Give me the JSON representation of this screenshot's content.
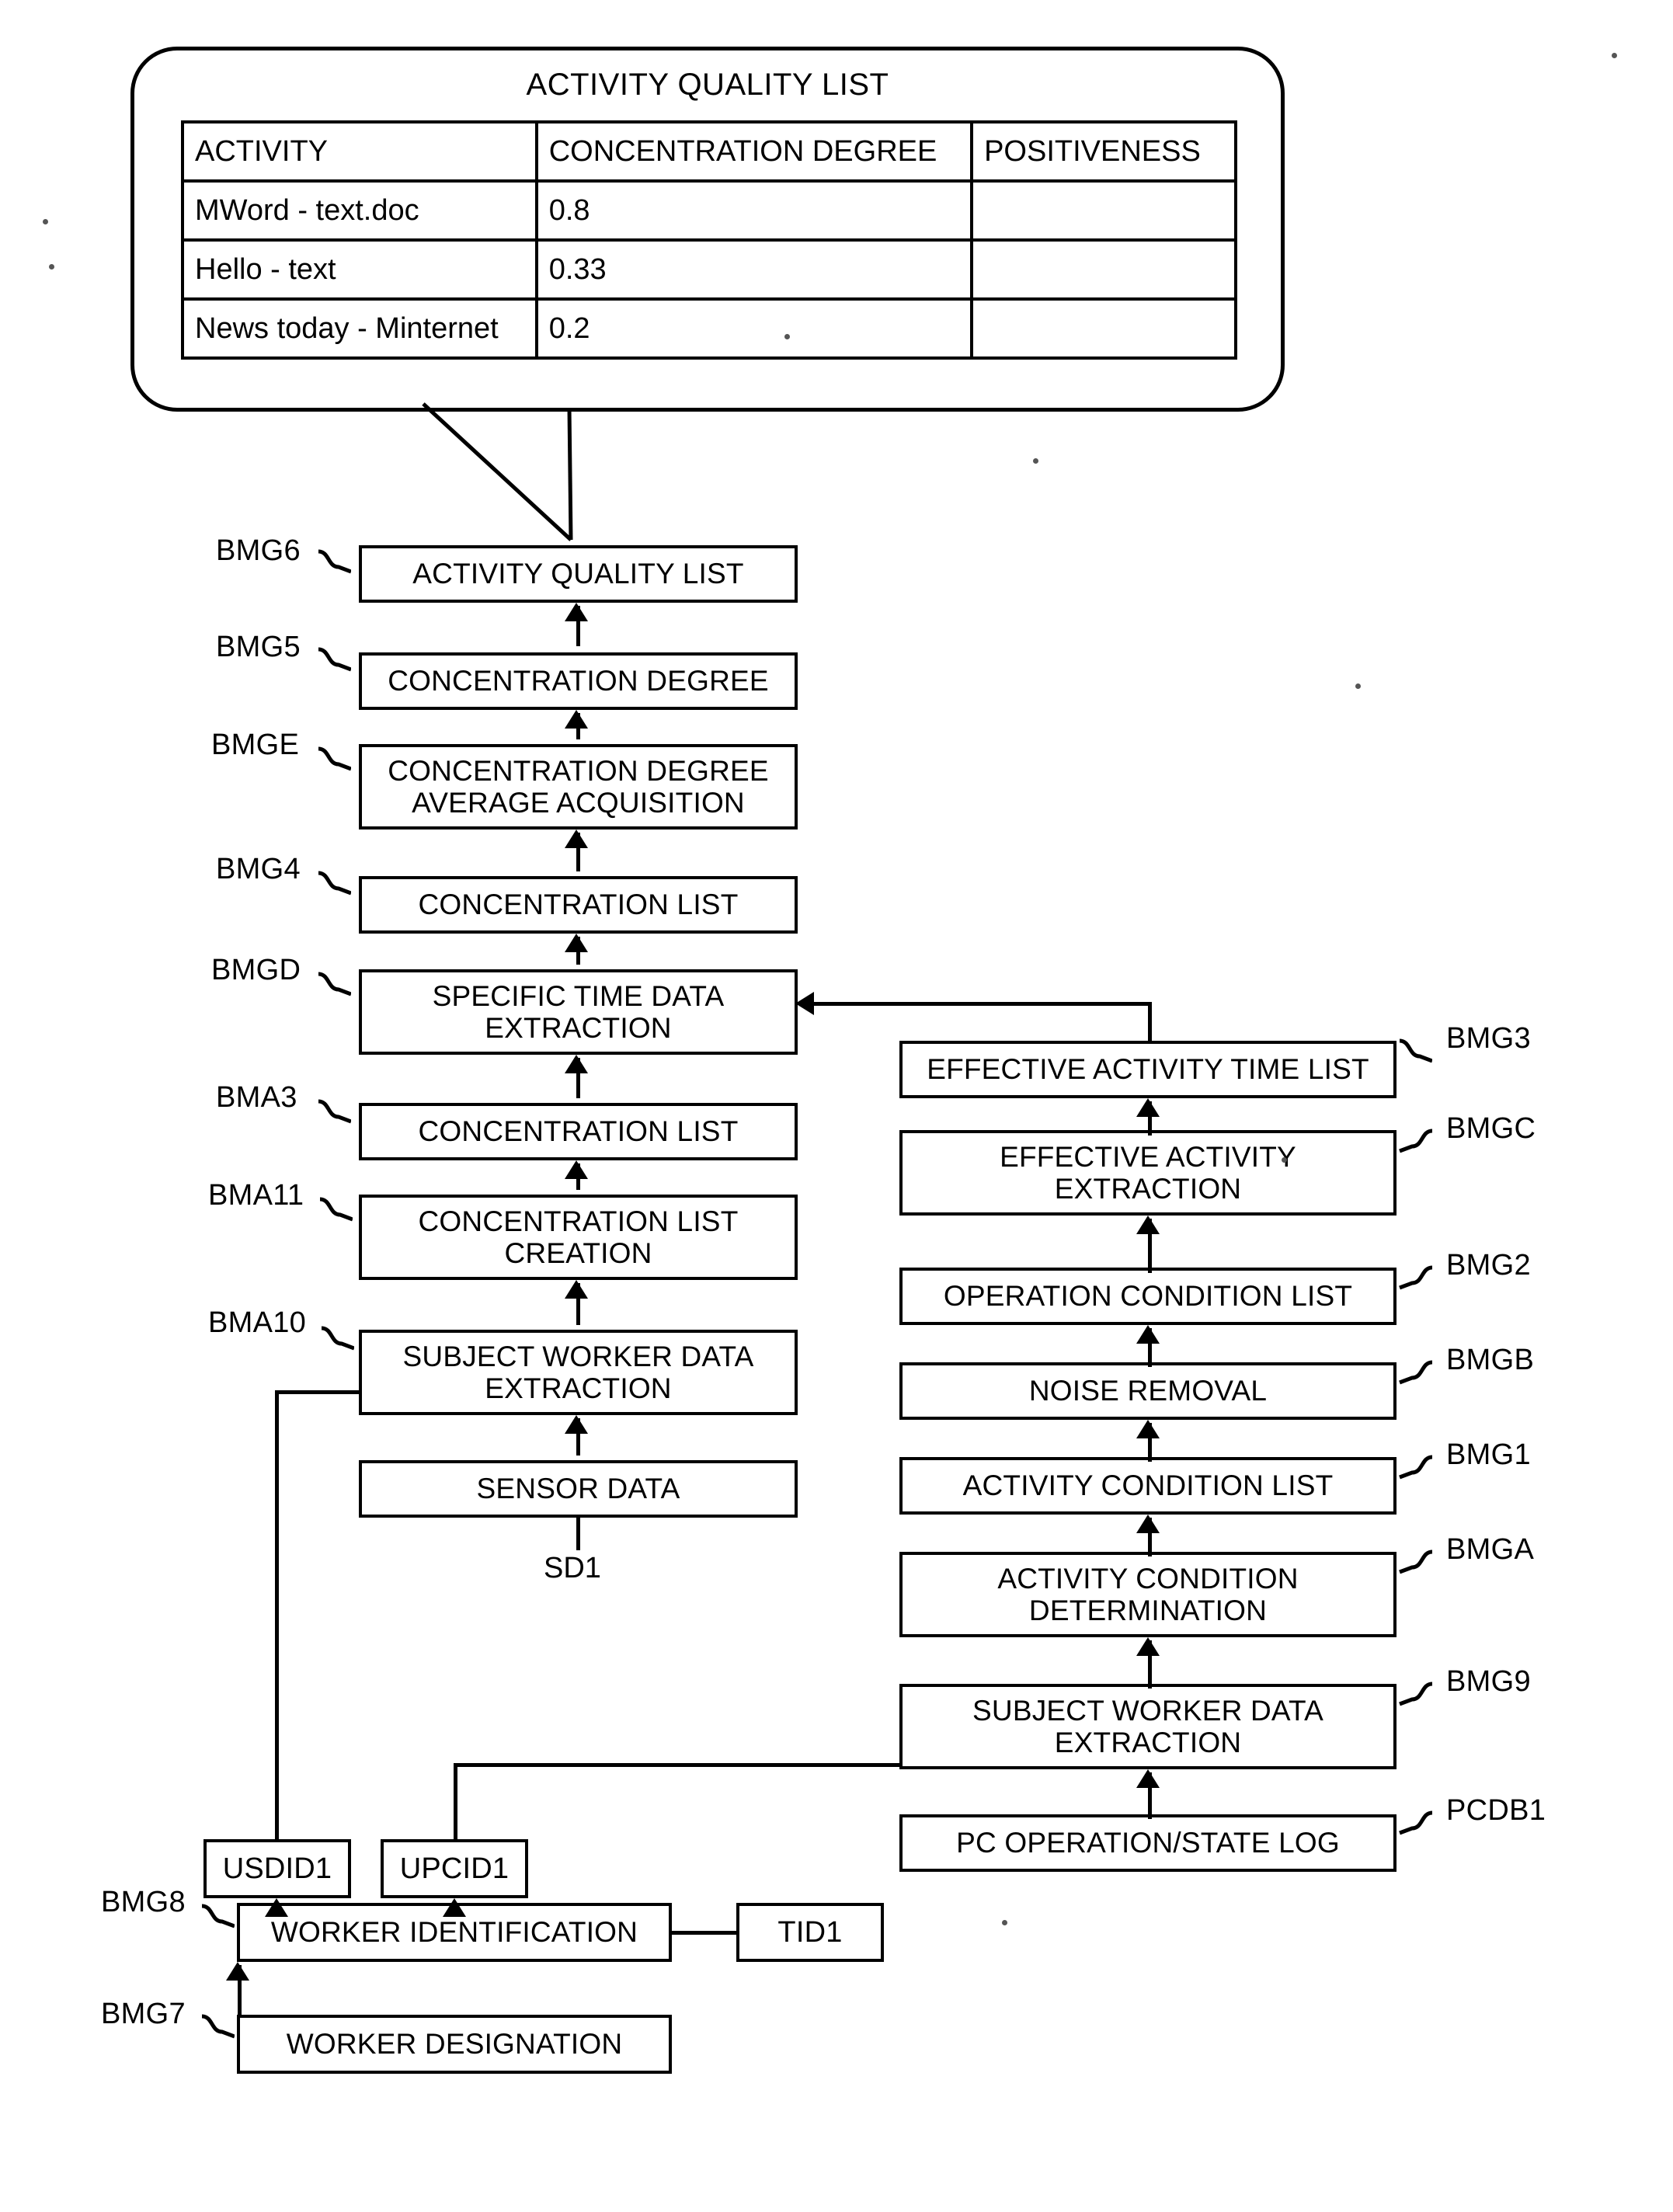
{
  "callout": {
    "title": "ACTIVITY QUALITY LIST",
    "columns": [
      "ACTIVITY",
      "CONCENTRATION DEGREE",
      "POSITIVENESS"
    ],
    "rows": [
      {
        "activity": "MWord - text.doc",
        "concentration": "0.8",
        "positiveness": ""
      },
      {
        "activity": "Hello - text",
        "concentration": "0.33",
        "positiveness": ""
      },
      {
        "activity": "News today - Minternet",
        "concentration": "0.2",
        "positiveness": ""
      }
    ]
  },
  "left_flow": [
    {
      "tag": "BMG6",
      "label": "ACTIVITY QUALITY LIST",
      "line2": ""
    },
    {
      "tag": "BMG5",
      "label": "CONCENTRATION DEGREE",
      "line2": ""
    },
    {
      "tag": "BMGE",
      "label": "CONCENTRATION DEGREE",
      "line2": "AVERAGE ACQUISITION"
    },
    {
      "tag": "BMG4",
      "label": "CONCENTRATION LIST",
      "line2": ""
    },
    {
      "tag": "BMGD",
      "label": "SPECIFIC TIME DATA",
      "line2": "EXTRACTION"
    },
    {
      "tag": "BMA3",
      "label": "CONCENTRATION LIST",
      "line2": ""
    },
    {
      "tag": "BMA11",
      "label": "CONCENTRATION LIST",
      "line2": "CREATION"
    },
    {
      "tag": "BMA10",
      "label": "SUBJECT WORKER DATA",
      "line2": "EXTRACTION"
    },
    {
      "tag": "",
      "label": "SENSOR DATA",
      "line2": ""
    }
  ],
  "sensor_source": "SD1",
  "right_flow": [
    {
      "tag": "BMG3",
      "label": "EFFECTIVE ACTIVITY TIME LIST",
      "line2": ""
    },
    {
      "tag": "BMGC",
      "label": "EFFECTIVE ACTIVITY",
      "line2": "EXTRACTION"
    },
    {
      "tag": "BMG2",
      "label": "OPERATION CONDITION LIST",
      "line2": ""
    },
    {
      "tag": "BMGB",
      "label": "NOISE REMOVAL",
      "line2": ""
    },
    {
      "tag": "BMG1",
      "label": "ACTIVITY CONDITION LIST",
      "line2": ""
    },
    {
      "tag": "BMGA",
      "label": "ACTIVITY CONDITION",
      "line2": "DETERMINATION"
    },
    {
      "tag": "BMG9",
      "label": "SUBJECT WORKER DATA",
      "line2": "EXTRACTION"
    },
    {
      "tag": "PCDB1",
      "label": "PC OPERATION/STATE LOG",
      "line2": ""
    }
  ],
  "bottom": {
    "usdid": "USDID1",
    "upcid": "UPCID1",
    "worker_identification": {
      "tag": "BMG8",
      "label": "WORKER IDENTIFICATION"
    },
    "worker_designation": {
      "tag": "BMG7",
      "label": "WORKER DESIGNATION"
    },
    "tid": "TID1"
  }
}
